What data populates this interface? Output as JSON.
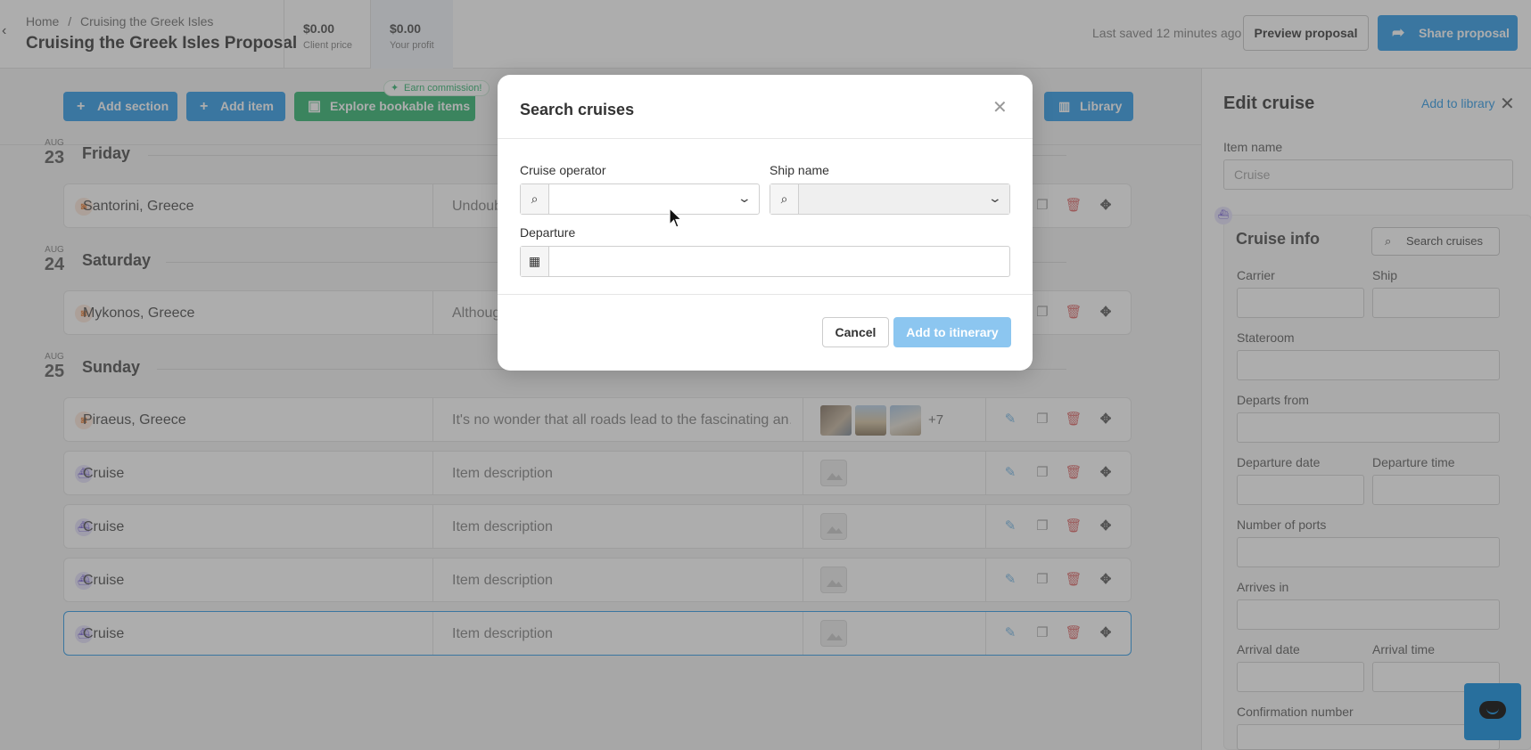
{
  "header": {
    "breadcrumb": [
      "Home",
      "/",
      "Cruising the Greek Isles"
    ],
    "title": "Cruising the Greek Isles Proposal",
    "client_price": {
      "value": "$0.00",
      "label": "Client price"
    },
    "your_profit": {
      "value": "$0.00",
      "label": "Your profit"
    },
    "last_saved": "Last saved 12 minutes ago",
    "preview_label": "Preview proposal",
    "share_label": "Share proposal"
  },
  "toolbar": {
    "add_section": "Add section",
    "add_item": "Add item",
    "explore": "Explore bookable items",
    "earn_badge": "Earn commission!",
    "library": "Library"
  },
  "days": [
    {
      "month": "AUG",
      "day": "23",
      "name": "Friday"
    },
    {
      "month": "AUG",
      "day": "24",
      "name": "Saturday"
    },
    {
      "month": "AUG",
      "day": "25",
      "name": "Sunday"
    }
  ],
  "rows": [
    {
      "title": "Santorini, Greece",
      "description": "Undoub",
      "icon": "camera-icon"
    },
    {
      "title": "Mykonos, Greece",
      "description": "Althoug",
      "icon": "camera-icon"
    },
    {
      "title": "Piraeus, Greece",
      "description": "It's no wonder that all roads lead to the fascinating an…",
      "icon": "camera-icon",
      "more": "+7"
    },
    {
      "title": "Cruise",
      "description": "Item description",
      "icon": "ship-icon"
    },
    {
      "title": "Cruise",
      "description": "Item description",
      "icon": "ship-icon"
    },
    {
      "title": "Cruise",
      "description": "Item description",
      "icon": "ship-icon"
    },
    {
      "title": "Cruise",
      "description": "Item description",
      "icon": "ship-icon"
    }
  ],
  "panel": {
    "title": "Edit cruise",
    "add_to_library": "Add to library",
    "item_name_label": "Item name",
    "item_name_placeholder": "Cruise",
    "cruise_info_title": "Cruise info",
    "search_cruises": "Search cruises",
    "fields": {
      "carrier": "Carrier",
      "ship": "Ship",
      "stateroom": "Stateroom",
      "departs_from": "Departs from",
      "departure_date": "Departure date",
      "departure_time": "Departure time",
      "number_of_ports": "Number of ports",
      "arrives_in": "Arrives in",
      "arrival_date": "Arrival date",
      "arrival_time": "Arrival time",
      "confirmation_number": "Confirmation number"
    }
  },
  "modal": {
    "title": "Search cruises",
    "cruise_operator_label": "Cruise operator",
    "ship_name_label": "Ship name",
    "departure_label": "Departure",
    "cancel": "Cancel",
    "add_to_itinerary": "Add to itinerary"
  }
}
